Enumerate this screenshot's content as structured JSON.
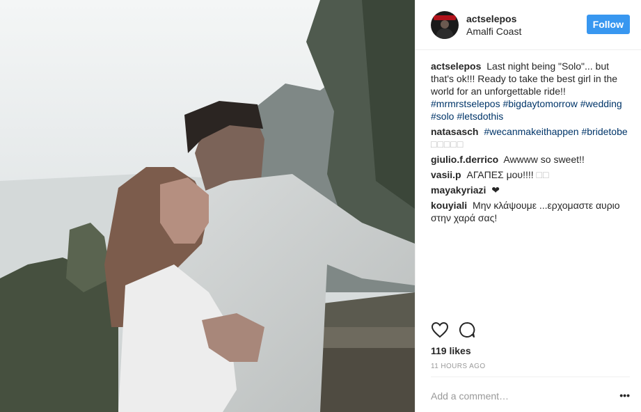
{
  "header": {
    "username": "actselepos",
    "location": "Amalfi Coast",
    "follow_label": "Follow"
  },
  "caption": {
    "username": "actselepos",
    "text": "Last night being \"Solo\"... but that's ok!!! Ready to take the best girl in the world for an unforgettable ride!!",
    "tags": [
      "#mrmrstselepos",
      "#bigdaytomorrow",
      "#wedding",
      "#solo",
      "#letsdothis"
    ]
  },
  "comments": [
    {
      "username": "natasasch",
      "tags": [
        "#wecanmakeithappen",
        "#bridetobe"
      ],
      "text": "",
      "emoji": "□□□□□"
    },
    {
      "username": "giulio.f.derrico",
      "text": "Awwww so sweet!!"
    },
    {
      "username": "vasii.p",
      "text": "ΑΓΑΠΕΣ μου!!!!",
      "emoji": "□□"
    },
    {
      "username": "mayakyriazi",
      "text": "❤"
    },
    {
      "username": "kouyiali",
      "text": "Μην κλάψουμε ...ερχομαστε αυριο στην χαρά σας!"
    }
  ],
  "actions": {
    "like_icon": "heart-icon",
    "comment_icon": "comment-icon"
  },
  "likes": "119 likes",
  "time": "11 HOURS AGO",
  "comment_placeholder": "Add a comment…",
  "more_label": "•••"
}
